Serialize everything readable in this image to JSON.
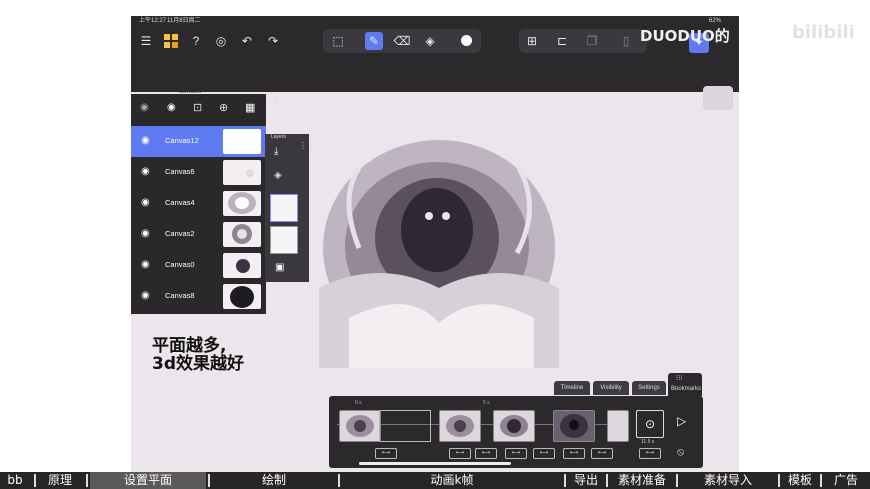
{
  "status": {
    "time": "上午12:27",
    "date": "11月8日周二",
    "battery": "62%"
  },
  "watermark": {
    "duoduo": "DUODUO的",
    "bilibili": "bilibili"
  },
  "panels": {
    "canvases_title": "Canvases",
    "layers_title": "Layers",
    "canvases": [
      {
        "name": "Canvas12",
        "selected": true
      },
      {
        "name": "Canvas6",
        "selected": false
      },
      {
        "name": "Canvas4",
        "selected": false
      },
      {
        "name": "Canvas2",
        "selected": false
      },
      {
        "name": "Canvas0",
        "selected": false
      },
      {
        "name": "Canvas8",
        "selected": false
      }
    ]
  },
  "caption": {
    "line1": "平面越多,",
    "line2": "3d效果越好"
  },
  "timeline": {
    "tabs": [
      "Timeline",
      "Visibility",
      "Settings",
      "Bookmarks"
    ],
    "marker_0": "0 s",
    "marker_1": "5 s",
    "time_readout": "11.5 s"
  },
  "chapters": [
    "bb",
    "原理",
    "设置平面",
    "绘制",
    "动画k帧",
    "导出",
    "素材准备",
    "素材导入",
    "模板",
    "广告"
  ],
  "colors": {
    "accent": "#5e7bf2",
    "toolbar": "#2b292c",
    "canvas": "#ece6ec"
  }
}
